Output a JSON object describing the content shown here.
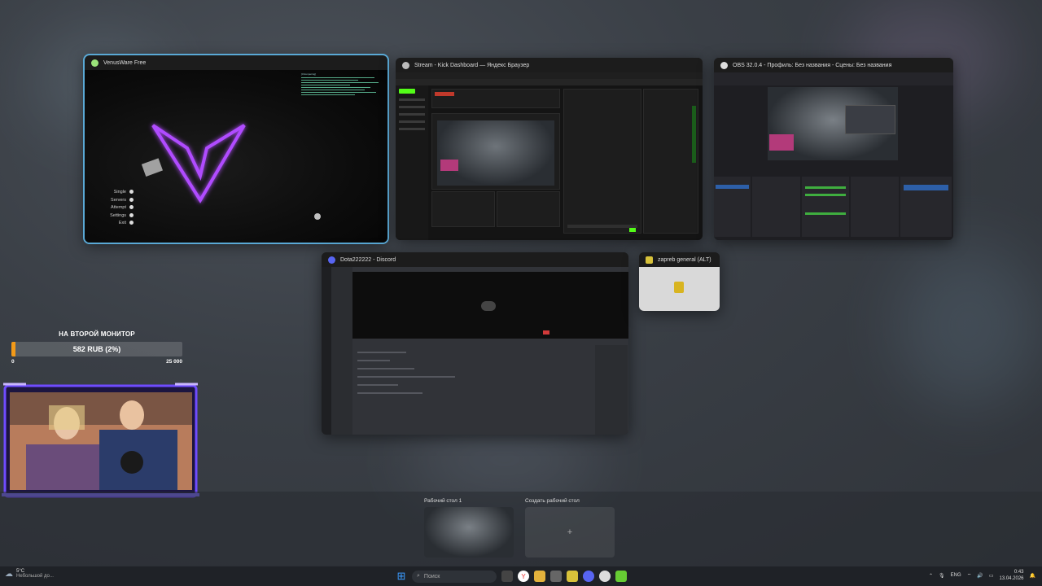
{
  "windows": {
    "venusware": {
      "title": "VenusWare Free",
      "menu": [
        "Single",
        "Servers",
        "Attempt",
        "Settings",
        "Exit"
      ],
      "log_heading": "[Chompering]"
    },
    "kick": {
      "title": "Stream - Kick Dashboard — Яндекс Браузер"
    },
    "obs": {
      "title": "OBS 32.0.4 - Профиль: Без названия - Сцены: Без названия"
    },
    "discord": {
      "title": "Dota222222 - Discord"
    },
    "alt": {
      "title": "zapreb general (ALT)"
    }
  },
  "donation": {
    "heading": "НА ВТОРОЙ МОНИТОР",
    "bar_label": "582 RUB (2%)",
    "progress_fraction": 0.023,
    "min_label": "0",
    "max_label": "25 000",
    "accent": "#f39a18"
  },
  "desktops": {
    "current_label": "Рабочий стол 1",
    "new_label": "Создать рабочий стол",
    "new_symbol": "+"
  },
  "taskbar": {
    "weather_temp": "5°C",
    "weather_desc": "Небольшой до...",
    "search_placeholder": "Поиск",
    "language": "ENG",
    "time": "0:43",
    "date": "13.04.2026"
  }
}
